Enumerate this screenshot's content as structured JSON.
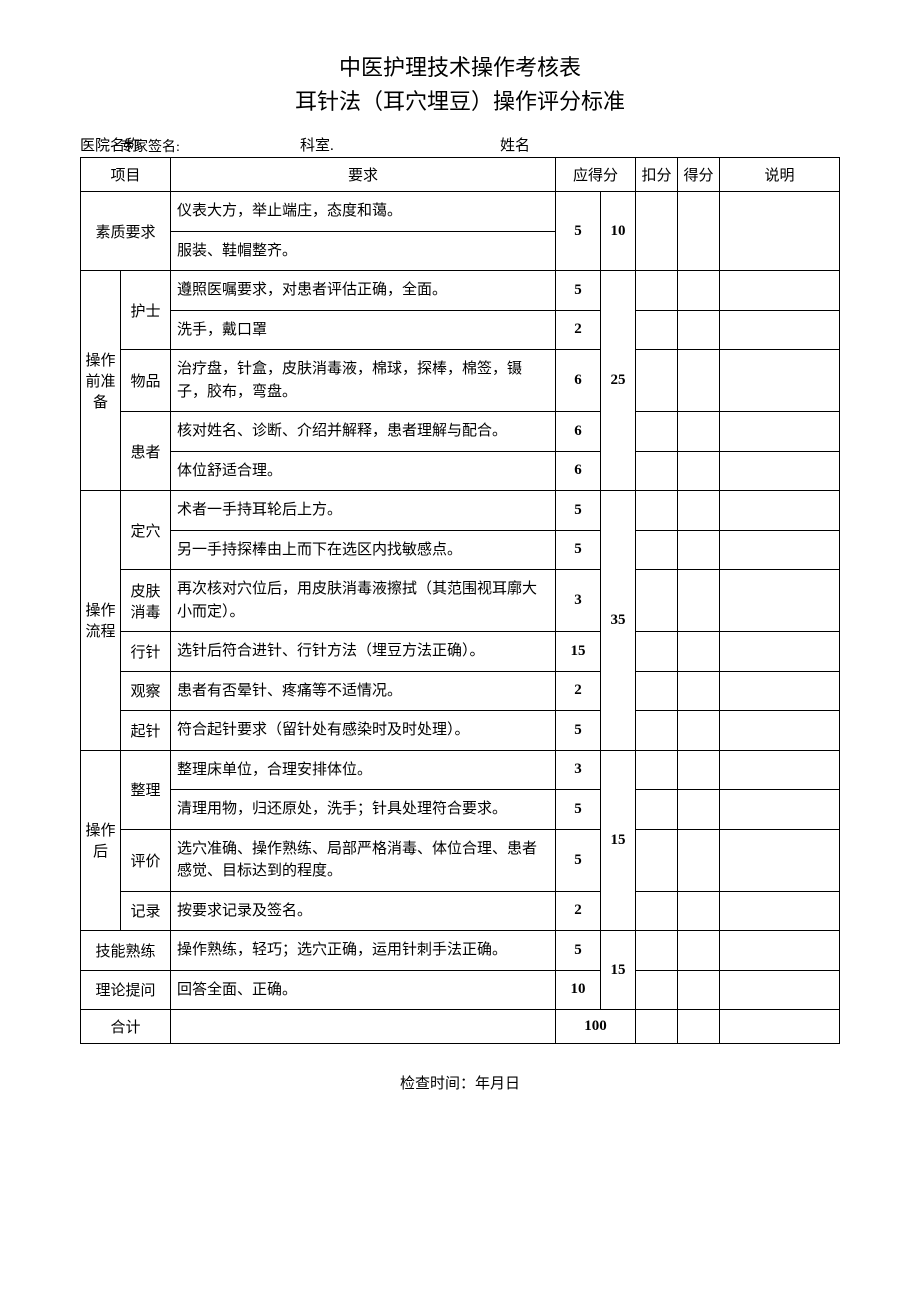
{
  "title": "中医护理技术操作考核表",
  "subtitle": "耳针法（耳穴埋豆）操作评分标准",
  "header": {
    "hospital_label": "医院名称",
    "expert_sig": "专家签名:",
    "dept_label": "科室.",
    "name_label": "姓名"
  },
  "columns": {
    "item": "项目",
    "requirement": "要求",
    "score_due": "应得分",
    "deduct": "扣分",
    "got": "得分",
    "note": "说明"
  },
  "sections": {
    "quality": {
      "label": "素质要求",
      "rows": [
        {
          "req": "仪表大方，举止端庄，态度和蔼。",
          "score": "5"
        },
        {
          "req": "服装、鞋帽整齐。",
          "score": ""
        }
      ],
      "total": "10"
    },
    "prep": {
      "label": "操作前准备",
      "total": "25",
      "groups": [
        {
          "sub": "护士",
          "rows": [
            {
              "req": "遵照医嘱要求，对患者评估正确，全面。",
              "score": "5"
            },
            {
              "req": "洗手，戴口罩",
              "score": "2"
            }
          ]
        },
        {
          "sub": "物品",
          "rows": [
            {
              "req": "治疗盘，针盒，皮肤消毒液，棉球，探棒，棉签，镊子，胶布，弯盘。",
              "score": "6"
            }
          ]
        },
        {
          "sub": "患者",
          "rows": [
            {
              "req": "核对姓名、诊断、介绍并解释，患者理解与配合。",
              "score": "6"
            },
            {
              "req": "体位舒适合理。",
              "score": "6"
            }
          ]
        }
      ]
    },
    "process": {
      "label": "操作流程",
      "total": "35",
      "groups": [
        {
          "sub": "定穴",
          "rows": [
            {
              "req": "术者一手持耳轮后上方。",
              "score": "5"
            },
            {
              "req": "另一手持探棒由上而下在选区内找敏感点。",
              "score": "5"
            }
          ]
        },
        {
          "sub": "皮肤消毒",
          "rows": [
            {
              "req": "再次核对穴位后，用皮肤消毒液擦拭（其范围视耳廓大小而定）。",
              "score": "3"
            }
          ]
        },
        {
          "sub": "行针",
          "rows": [
            {
              "req": "选针后符合进针、行针方法（埋豆方法正确）。",
              "score": "15"
            }
          ]
        },
        {
          "sub": "观察",
          "rows": [
            {
              "req": "患者有否晕针、疼痛等不适情况。",
              "score": "2"
            }
          ]
        },
        {
          "sub": "起针",
          "rows": [
            {
              "req": "符合起针要求（留针处有感染时及时处理）。",
              "score": "5"
            }
          ]
        }
      ]
    },
    "post": {
      "label": "操作后",
      "total": "15",
      "groups": [
        {
          "sub": "整理",
          "rows": [
            {
              "req": "整理床单位，合理安排体位。",
              "score": "3"
            },
            {
              "req": "清理用物，归还原处，洗手；针具处理符合要求。",
              "score": "5"
            }
          ]
        },
        {
          "sub": "评价",
          "rows": [
            {
              "req": "选穴准确、操作熟练、局部严格消毒、体位合理、患者感觉、目标达到的程度。",
              "score": "5"
            }
          ]
        },
        {
          "sub": "记录",
          "rows": [
            {
              "req": "按要求记录及签名。",
              "score": "2"
            }
          ]
        }
      ]
    },
    "skill": {
      "label": "技能熟练",
      "req": "操作熟练，轻巧；选穴正确，运用针刺手法正确。",
      "score": "5",
      "total": "15"
    },
    "theory": {
      "label": "理论提问",
      "req": "回答全面、正确。",
      "score": "10"
    },
    "sum": {
      "label": "合计",
      "total": "100"
    }
  },
  "footer": "检查时间：年月日"
}
